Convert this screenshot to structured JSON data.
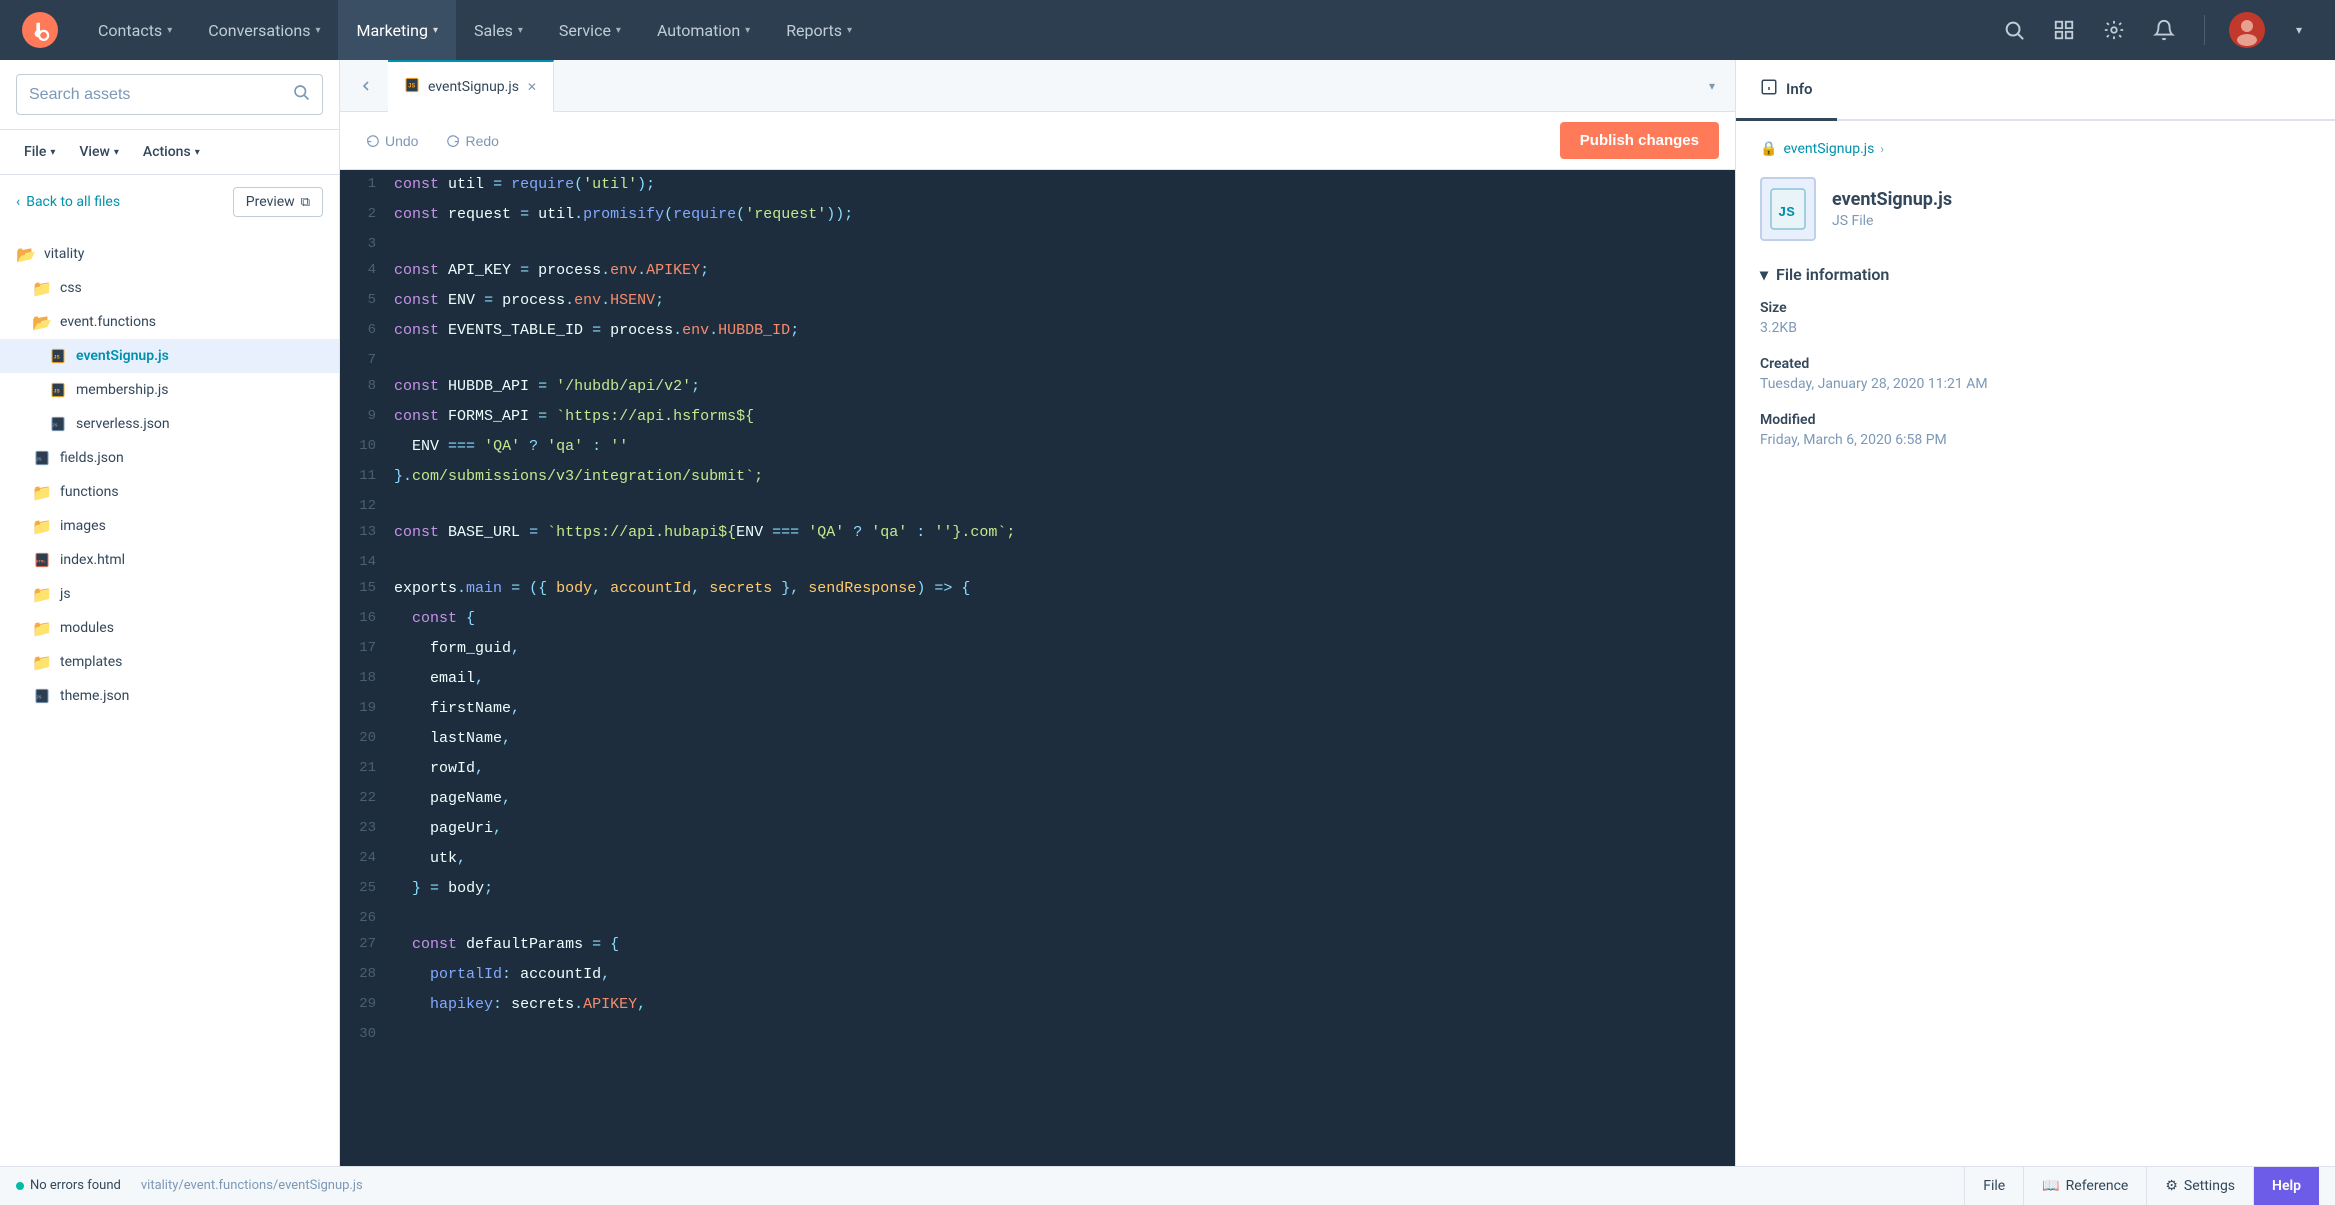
{
  "nav": {
    "items": [
      {
        "label": "Contacts",
        "has_chevron": true
      },
      {
        "label": "Conversations",
        "has_chevron": true
      },
      {
        "label": "Marketing",
        "has_chevron": true,
        "active": true
      },
      {
        "label": "Sales",
        "has_chevron": true
      },
      {
        "label": "Service",
        "has_chevron": true
      },
      {
        "label": "Automation",
        "has_chevron": true
      },
      {
        "label": "Reports",
        "has_chevron": true
      }
    ]
  },
  "sidebar": {
    "search_placeholder": "Search assets",
    "toolbar": {
      "file_label": "File",
      "view_label": "View",
      "actions_label": "Actions"
    },
    "back_label": "Back to all files",
    "preview_label": "Preview",
    "tree": [
      {
        "name": "vitality",
        "type": "folder-teal",
        "indent": 0
      },
      {
        "name": "css",
        "type": "folder",
        "indent": 1
      },
      {
        "name": "event.functions",
        "type": "folder-teal",
        "indent": 1
      },
      {
        "name": "eventSignup.js",
        "type": "file-js",
        "indent": 2,
        "active": true
      },
      {
        "name": "membership.js",
        "type": "file-js",
        "indent": 2
      },
      {
        "name": "serverless.json",
        "type": "file-json",
        "indent": 2
      },
      {
        "name": "fields.json",
        "type": "file-json",
        "indent": 1
      },
      {
        "name": "functions",
        "type": "folder",
        "indent": 1
      },
      {
        "name": "images",
        "type": "folder",
        "indent": 1
      },
      {
        "name": "index.html",
        "type": "file-html",
        "indent": 1
      },
      {
        "name": "js",
        "type": "folder",
        "indent": 1
      },
      {
        "name": "modules",
        "type": "folder",
        "indent": 1
      },
      {
        "name": "templates",
        "type": "folder",
        "indent": 1
      },
      {
        "name": "theme.json",
        "type": "file-json",
        "indent": 1
      }
    ]
  },
  "editor": {
    "tab_filename": "eventSignup.js",
    "undo_label": "Undo",
    "redo_label": "Redo",
    "publish_label": "Publish changes",
    "lines": [
      {
        "num": 1,
        "content": "const util = require('util');"
      },
      {
        "num": 2,
        "content": "const request = util.promisify(require('request'));"
      },
      {
        "num": 3,
        "content": ""
      },
      {
        "num": 4,
        "content": "const API_KEY = process.env.APIKEY;"
      },
      {
        "num": 5,
        "content": "const ENV = process.env.HSENV;"
      },
      {
        "num": 6,
        "content": "const EVENTS_TABLE_ID = process.env.HUBDB_ID;"
      },
      {
        "num": 7,
        "content": ""
      },
      {
        "num": 8,
        "content": "const HUBDB_API = '/hubdb/api/v2';"
      },
      {
        "num": 9,
        "content": "const FORMS_API = `https://api.hsforms${"
      },
      {
        "num": 10,
        "content": "  ENV === 'QA' ? 'qa' : ''"
      },
      {
        "num": 11,
        "content": "}.com/submissions/v3/integration/submit`;"
      },
      {
        "num": 12,
        "content": ""
      },
      {
        "num": 13,
        "content": "const BASE_URL = `https://api.hubapi${ENV === 'QA' ? 'qa' : ''}.com`;"
      },
      {
        "num": 14,
        "content": ""
      },
      {
        "num": 15,
        "content": "exports.main = ({ body, accountId, secrets }, sendResponse) => {"
      },
      {
        "num": 16,
        "content": "  const {"
      },
      {
        "num": 17,
        "content": "    form_guid,"
      },
      {
        "num": 18,
        "content": "    email,"
      },
      {
        "num": 19,
        "content": "    firstName,"
      },
      {
        "num": 20,
        "content": "    lastName,"
      },
      {
        "num": 21,
        "content": "    rowId,"
      },
      {
        "num": 22,
        "content": "    pageName,"
      },
      {
        "num": 23,
        "content": "    pageUri,"
      },
      {
        "num": 24,
        "content": "    utk,"
      },
      {
        "num": 25,
        "content": "  } = body;"
      },
      {
        "num": 26,
        "content": ""
      },
      {
        "num": 27,
        "content": "  const defaultParams = {"
      },
      {
        "num": 28,
        "content": "    portalId: accountId,"
      },
      {
        "num": 29,
        "content": "    hapikey: secrets.APIKEY,"
      },
      {
        "num": 30,
        "content": ""
      }
    ]
  },
  "right_panel": {
    "tab_info": "Info",
    "breadcrumb": "eventSignup.js",
    "file_name": "eventSignup.js",
    "file_type": "JS File",
    "section_label": "File information",
    "size_label": "Size",
    "size_value": "3.2KB",
    "created_label": "Created",
    "created_value": "Tuesday, January 28, 2020 11:21 AM",
    "modified_label": "Modified",
    "modified_value": "Friday, March 6, 2020 6:58 PM"
  },
  "bottom_bar": {
    "status_label": "No errors found",
    "file_label": "File",
    "path": "vitality/event.functions/eventSignup.js",
    "reference_label": "Reference",
    "settings_label": "Settings",
    "help_label": "Help"
  }
}
